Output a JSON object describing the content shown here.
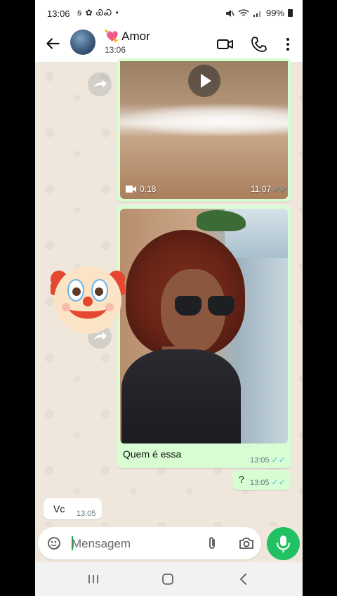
{
  "status_bar": {
    "time": "13:06",
    "indicators": "ꞩ ✿ ᏯᏍ •",
    "battery": "99%"
  },
  "header": {
    "contact_name": "Amor",
    "contact_emoji": "💘",
    "contact_status": "13:06"
  },
  "messages": {
    "video": {
      "duration": "0:18",
      "time": "11:07"
    },
    "photo": {
      "caption": "Quem é essa",
      "time": "13:05"
    },
    "question": {
      "text": "?",
      "time": "13:05"
    },
    "incoming": {
      "text": "Vc",
      "time": "13:05"
    },
    "reaction_emoji": "🤡"
  },
  "composer": {
    "placeholder": "Mensagem"
  },
  "icons": {
    "back": "arrow-left-icon",
    "video_call": "video-call-icon",
    "voice_call": "phone-icon",
    "menu": "more-vertical-icon",
    "sticker": "sticker-icon",
    "attach": "paperclip-icon",
    "camera": "camera-icon",
    "mic": "microphone-icon"
  },
  "colors": {
    "accent": "#21c063",
    "outgoing_bubble": "#d9fdd3",
    "read_ticks": "#53bdeb"
  }
}
